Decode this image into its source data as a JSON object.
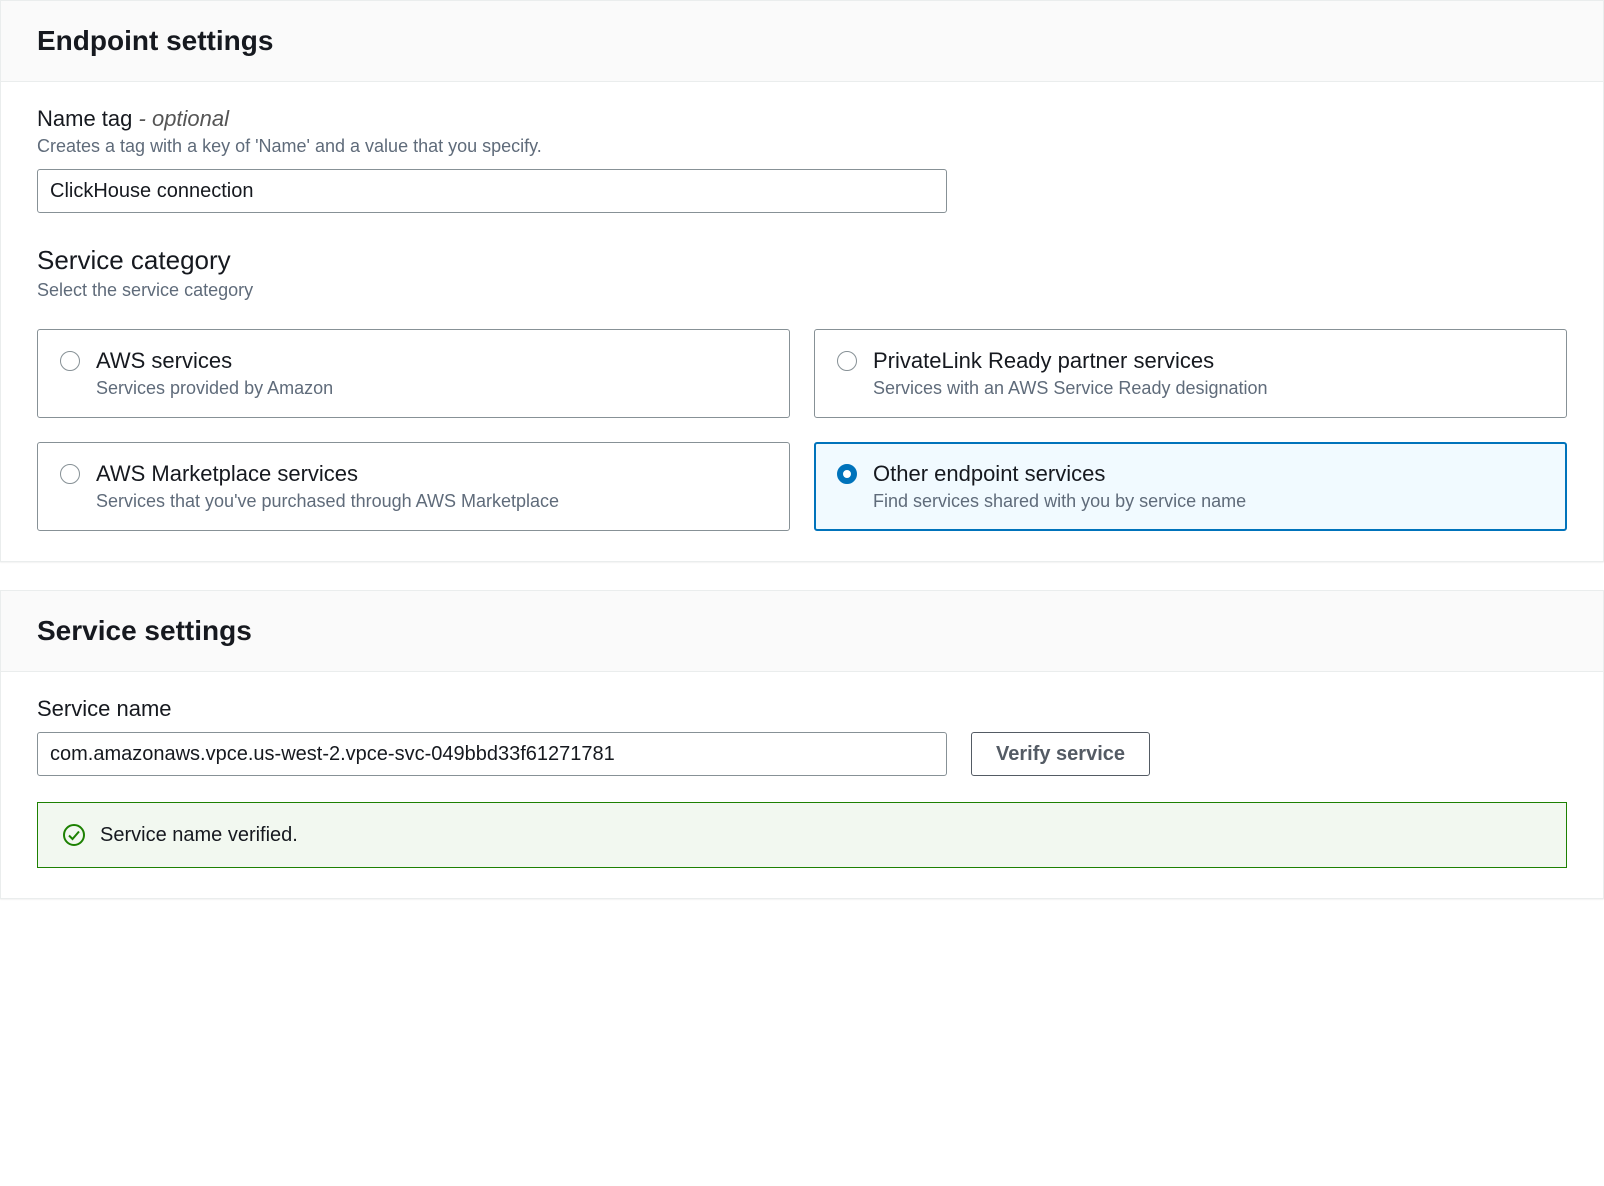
{
  "endpoint_settings": {
    "header": "Endpoint settings",
    "name_tag": {
      "label": "Name tag",
      "optional_suffix": "- optional",
      "description": "Creates a tag with a key of 'Name' and a value that you specify.",
      "value": "ClickHouse connection"
    },
    "service_category": {
      "heading": "Service category",
      "description": "Select the service category",
      "options": [
        {
          "id": "aws-services",
          "title": "AWS services",
          "desc": "Services provided by Amazon",
          "selected": false
        },
        {
          "id": "privatelink-partner",
          "title": "PrivateLink Ready partner services",
          "desc": "Services with an AWS Service Ready designation",
          "selected": false
        },
        {
          "id": "aws-marketplace",
          "title": "AWS Marketplace services",
          "desc": "Services that you've purchased through AWS Marketplace",
          "selected": false
        },
        {
          "id": "other-endpoint",
          "title": "Other endpoint services",
          "desc": "Find services shared with you by service name",
          "selected": true
        }
      ]
    }
  },
  "service_settings": {
    "header": "Service settings",
    "service_name": {
      "label": "Service name",
      "value": "com.amazonaws.vpce.us-west-2.vpce-svc-049bbd33f61271781",
      "verify_button": "Verify service"
    },
    "alert": {
      "text": "Service name verified."
    }
  }
}
